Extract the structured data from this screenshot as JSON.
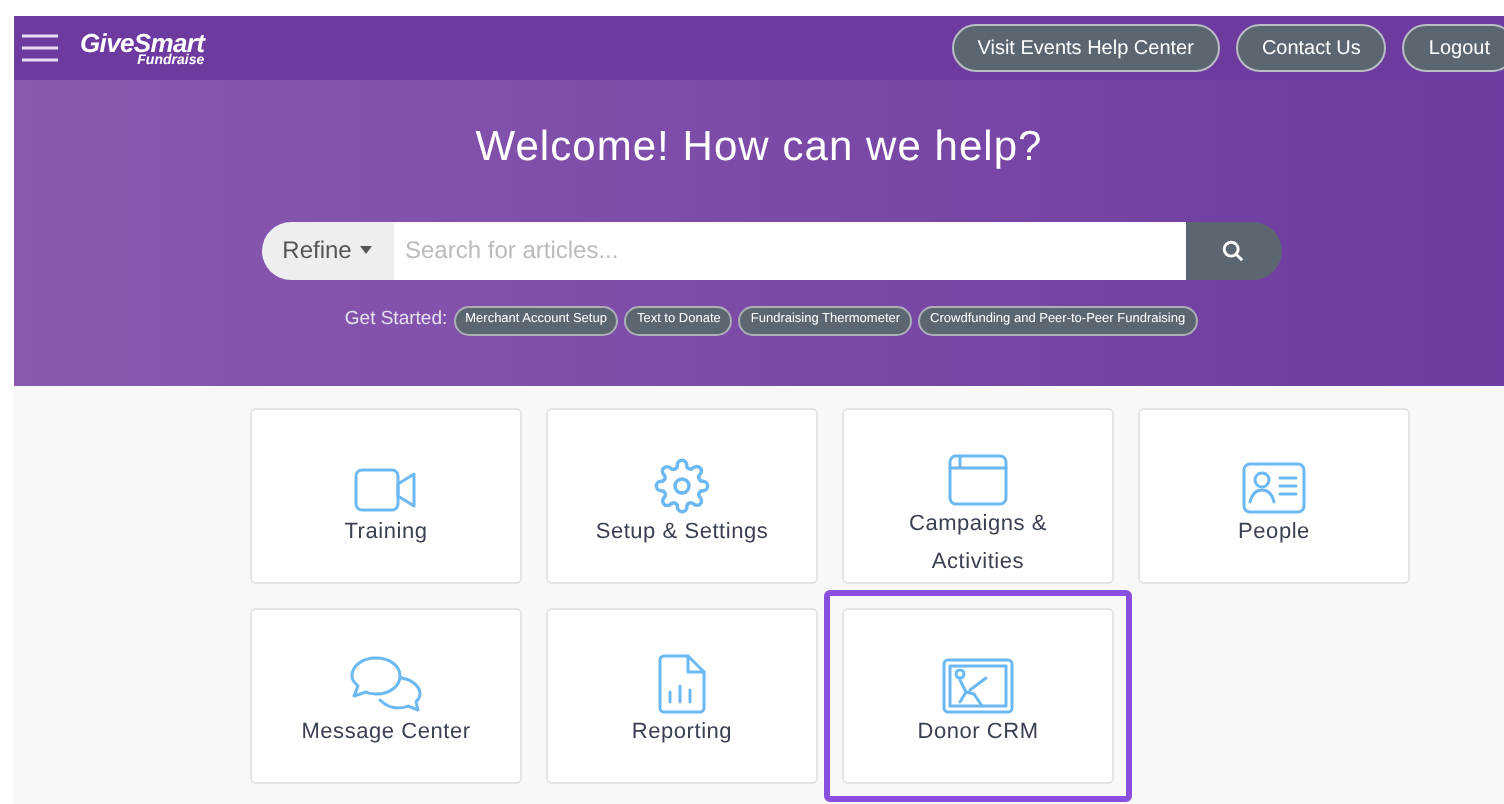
{
  "header": {
    "logo": {
      "name": "GiveSmart",
      "sub": "Fundraise"
    },
    "buttons": [
      "Visit Events Help Center",
      "Contact Us",
      "Logout"
    ]
  },
  "hero": {
    "title": "Welcome! How can we help?",
    "search": {
      "refine": "Refine",
      "placeholder": "Search for articles..."
    },
    "get_started": {
      "label": "Get Started:",
      "chips": [
        "Merchant Account Setup",
        "Text to Donate",
        "Fundraising Thermometer",
        "Crowdfunding and Peer-to-Peer Fundraising"
      ]
    }
  },
  "categories": [
    {
      "kind": "video",
      "label": "Training",
      "highlighted": false
    },
    {
      "kind": "gear",
      "label": "Setup & Settings",
      "highlighted": false
    },
    {
      "kind": "window",
      "label": "Campaigns & Activities",
      "highlighted": false
    },
    {
      "kind": "contact",
      "label": "People",
      "highlighted": false
    },
    {
      "kind": "chat",
      "label": "Message Center",
      "highlighted": false
    },
    {
      "kind": "report",
      "label": "Reporting",
      "highlighted": false
    },
    {
      "kind": "crm",
      "label": "Donor CRM",
      "highlighted": true
    }
  ]
}
